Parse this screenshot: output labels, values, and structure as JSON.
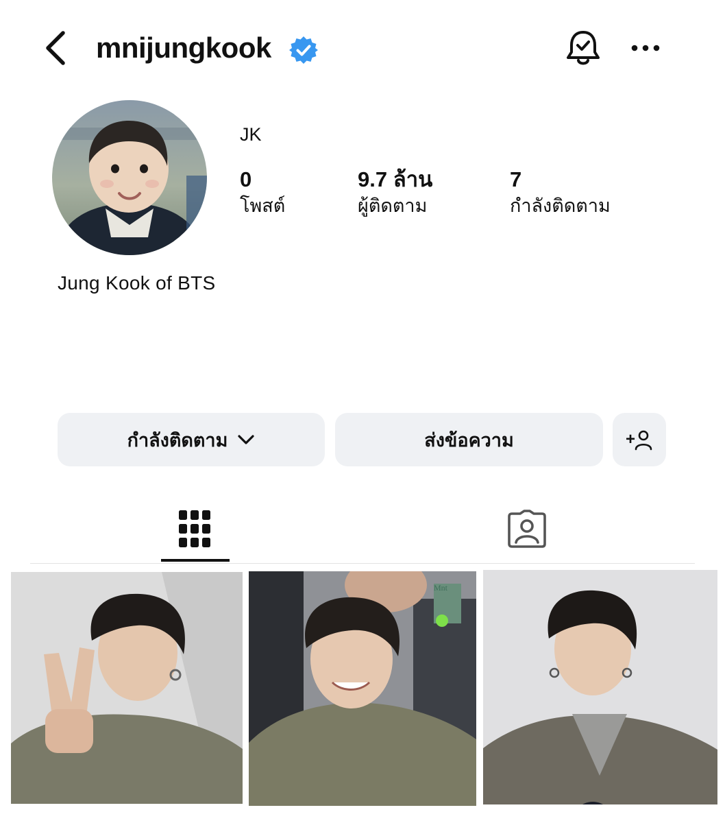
{
  "header": {
    "username": "mnijungkook"
  },
  "profile": {
    "display_name": "JK",
    "bio": "Jung Kook of BTS",
    "stats": {
      "posts": {
        "value": "0",
        "label": "โพสต์"
      },
      "followers": {
        "value": "9.7 ล้าน",
        "label": "ผู้ติดตาม"
      },
      "following": {
        "value": "7",
        "label": "กำลังติดตาม"
      }
    }
  },
  "actions": {
    "following_label": "กำลังติดตาม",
    "message_label": "ส่งข้อความ",
    "add_user_label": "+"
  },
  "tabs": [
    {
      "icon": "grid-icon",
      "active": true
    },
    {
      "icon": "tagged-person-icon",
      "active": false
    }
  ],
  "posts": [
    {
      "icon": "photo"
    },
    {
      "icon": "photo",
      "overlay_text": "Mnt"
    },
    {
      "icon": "photo"
    }
  ],
  "colors": {
    "verified_blue": "#3897f0",
    "button_bg": "#eff1f4",
    "text": "#111111"
  }
}
